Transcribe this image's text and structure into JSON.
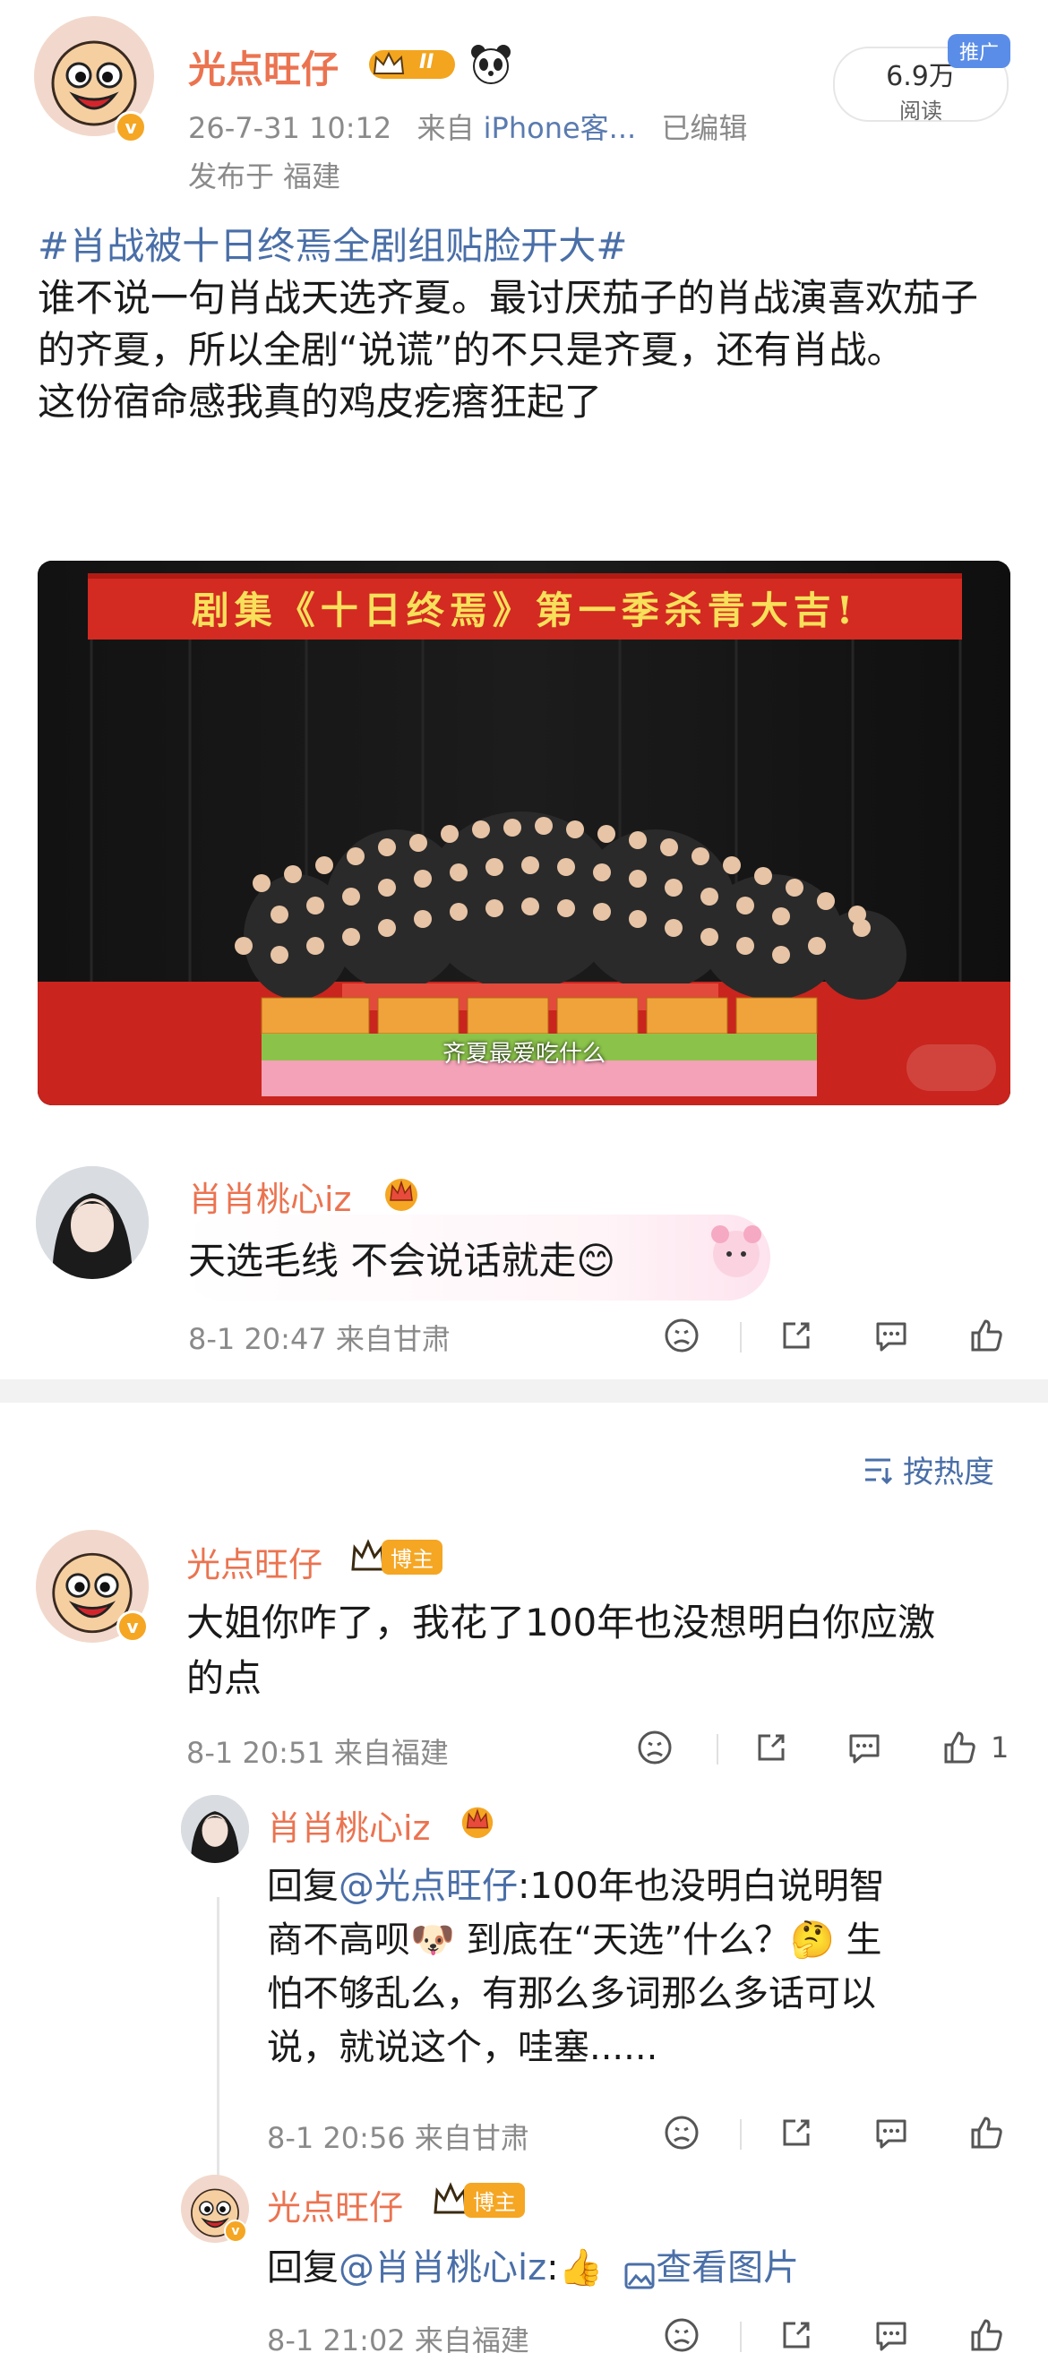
{
  "post": {
    "author": "光点旺仔",
    "level_badge": "II",
    "date": "26-7-31 10:12",
    "source_prefix": "来自",
    "source": "iPhone客...",
    "edited": "已编辑",
    "location": "发布于 福建",
    "reads": "6.9万",
    "reads_label": "阅读",
    "promo_tag": "推广",
    "hashtag": "#肖战被十日终焉全剧组贴脸开大#",
    "paragraph1": "谁不说一句肖战天选齐夏。最讨厌茄子的肖战演喜欢茄子的齐夏，所以全剧“说谎”的不只是齐夏，还有肖战。",
    "paragraph2": "这份宿命感我真的鸡皮疙瘩狂起了",
    "photo": {
      "banner": "剧集《十日终焉》第一季杀青大吉!",
      "subtitle": "齐夏最爱吃什么"
    }
  },
  "top_comment": {
    "author": "肖肖桃心iz",
    "text": "天选毛线 不会说话就走😊",
    "meta": "8-1 20:47 来自甘肃"
  },
  "sort": {
    "label": "按热度"
  },
  "comments": [
    {
      "author": "光点旺仔",
      "badge": "博主",
      "text_line1": "大姐你咋了，我花了100年也没想明白你应激",
      "text_line2": "的点",
      "meta": "8-1 20:51 来自福建",
      "likes": "1"
    }
  ],
  "replies": [
    {
      "author": "肖肖桃心iz",
      "prefix": "回复",
      "mention": "@光点旺仔",
      "line1": ":100年也没明白说明智",
      "line2": "商不高呗🐶 到底在“天选”什么？🤔 生",
      "line3": "怕不够乱么，有那么多词那么多话可以",
      "line4": "说，就说这个，哇塞......",
      "meta": "8-1 20:56 来自甘肃"
    },
    {
      "author": "光点旺仔",
      "badge": "博主",
      "prefix": "回复",
      "mention": "@肖肖桃心iz",
      "after_mention": ":👍",
      "view_image": "查看图片",
      "meta": "8-1 21:02 来自福建"
    }
  ],
  "colors": {
    "orange_name": "#eb7350",
    "link_blue": "#4a6fa8",
    "meta_gray": "#8a8a8a",
    "blogger_badge": "#f5a623"
  },
  "icons": [
    "dislike-icon",
    "share-icon",
    "comment-icon",
    "like-icon",
    "sort-icon",
    "image-icon"
  ]
}
